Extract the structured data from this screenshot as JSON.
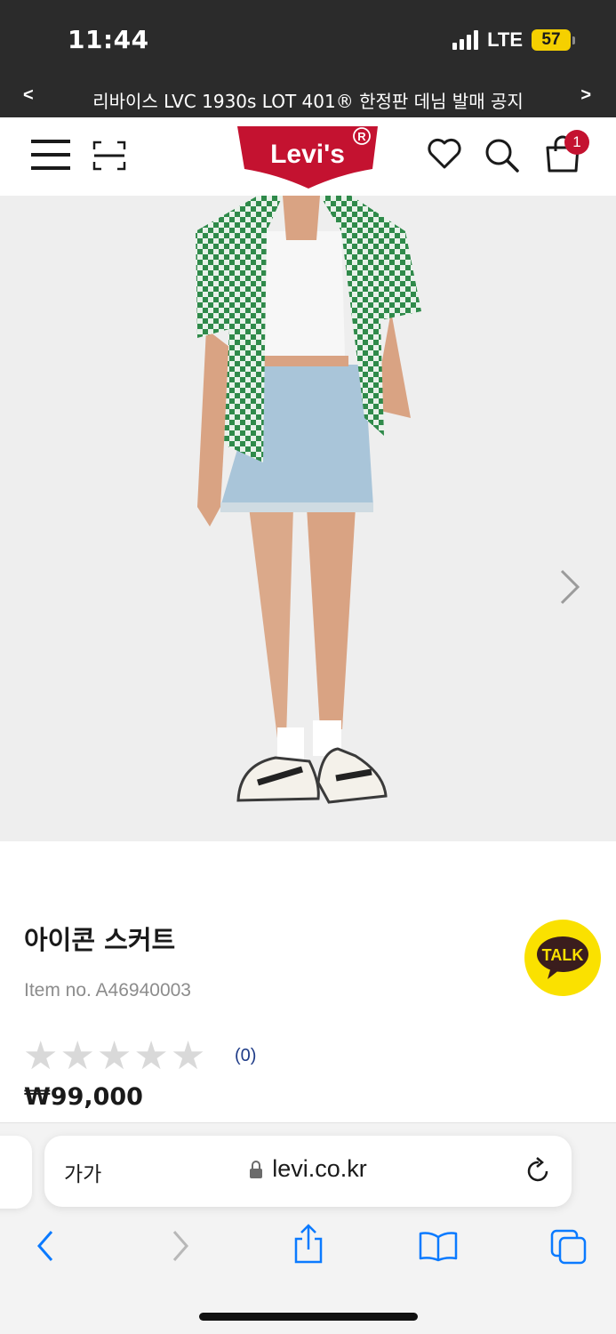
{
  "status_bar": {
    "time": "11:44",
    "network": "LTE",
    "battery": "57"
  },
  "announcement": {
    "prev_label": "<",
    "text": "리바이스 LVC 1930s LOT 401® 한정판 데님 발매 공지",
    "next_label": ">"
  },
  "header": {
    "logo_text": "Levi's",
    "cart_count": "1",
    "icons": [
      "menu-icon",
      "scan-icon",
      "heart-icon",
      "search-icon",
      "shopping-bag-icon"
    ]
  },
  "product": {
    "title": "아이콘 스커트",
    "item_no": "Item no. A46940003",
    "rating": 0,
    "rating_max": 5,
    "review_count": "(0)",
    "price": "₩99,000"
  },
  "kakao": {
    "label": "TALK"
  },
  "browser": {
    "text_size_label": "가가",
    "url": "levi.co.kr"
  },
  "colors": {
    "brand_red": "#c41230",
    "kakao_yellow": "#fae100",
    "ios_blue": "#0a7aff",
    "top_bar": "#2b2b2b"
  }
}
